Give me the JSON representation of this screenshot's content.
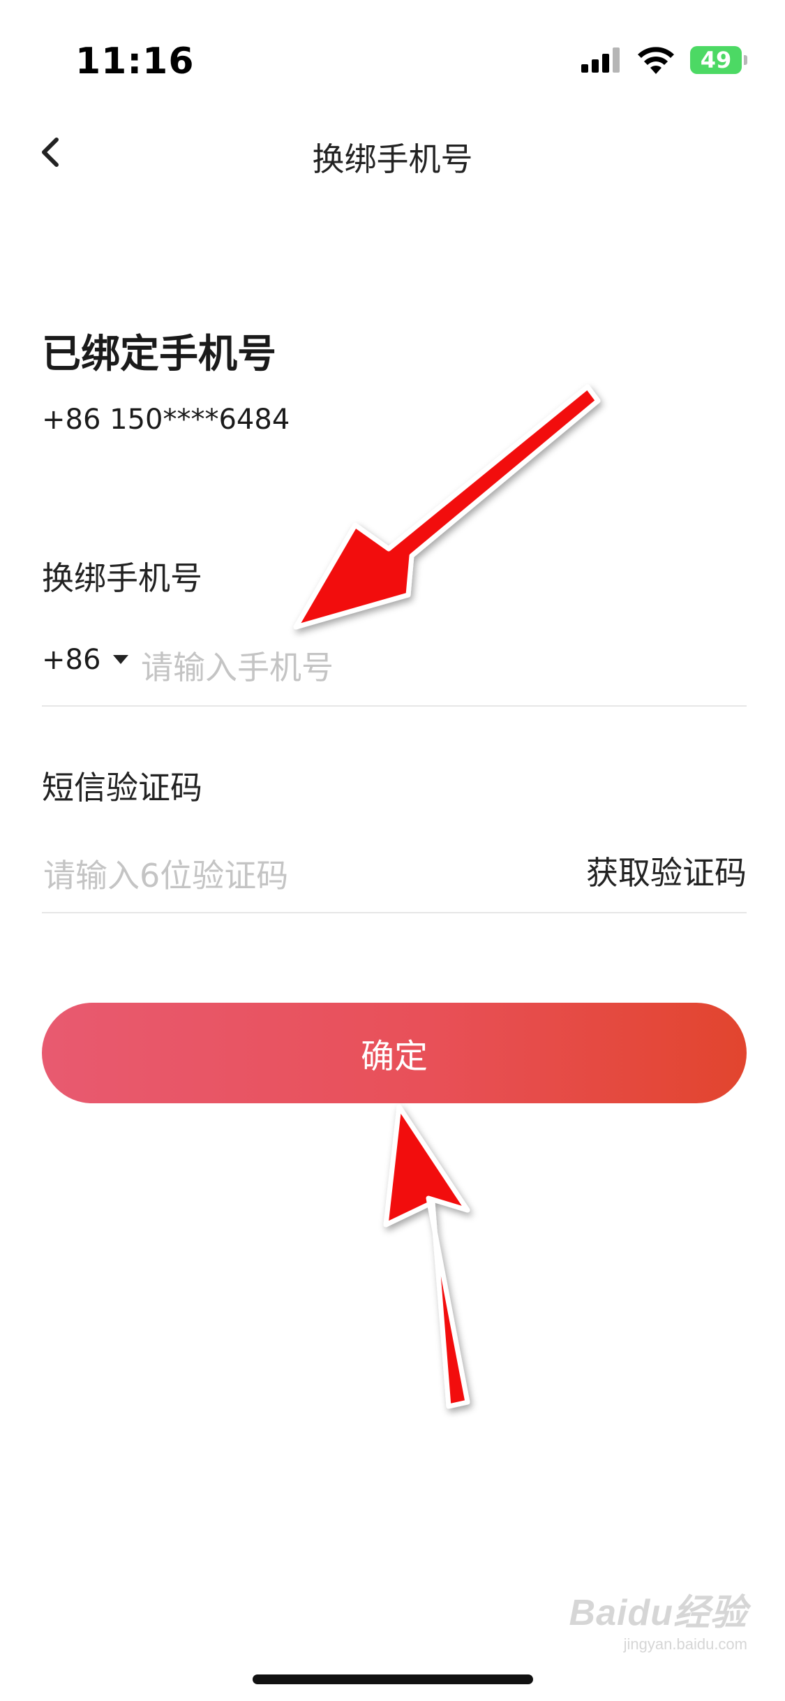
{
  "status_bar": {
    "time": "11:16",
    "battery_level": "49",
    "battery_color": "#4cd964",
    "icons": [
      "signal-icon",
      "wifi-icon",
      "battery-charging-icon"
    ]
  },
  "nav": {
    "title": "换绑手机号",
    "back_icon": "chevron-left-icon"
  },
  "bound": {
    "title": "已绑定手机号",
    "number": "+86 150****6484"
  },
  "new_phone": {
    "label": "换绑手机号",
    "country_code": "+86",
    "dropdown_icon": "caret-down-icon",
    "placeholder": "请输入手机号",
    "value": ""
  },
  "sms_code": {
    "label": "短信验证码",
    "placeholder": "请输入6位验证码",
    "value": "",
    "get_code_label": "获取验证码"
  },
  "confirm": {
    "label": "确定",
    "gradient_start": "#e85a70",
    "gradient_end": "#e2452e"
  },
  "annotation": {
    "arrow_color": "#f20d0d"
  },
  "watermark": {
    "logo": "Baidu经验",
    "sub": "jingyan.baidu.com"
  }
}
